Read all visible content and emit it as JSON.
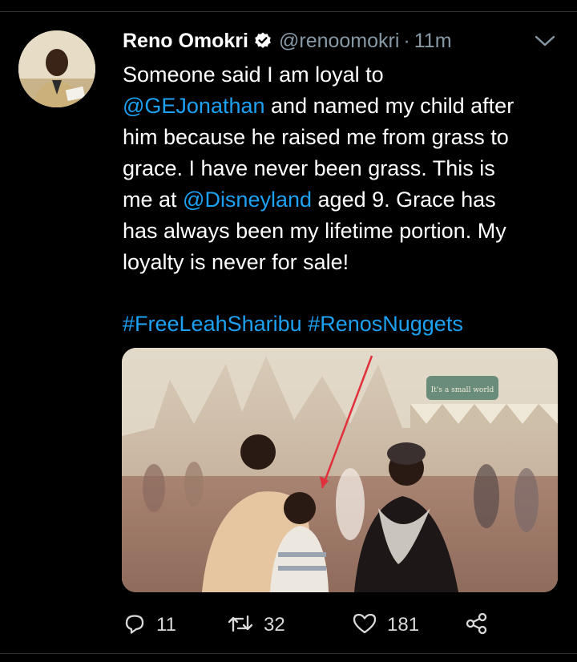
{
  "tweet": {
    "author": {
      "name": "Reno Omokri",
      "verified": true,
      "handle": "@renoomokri",
      "separator": "·",
      "time": "11m"
    },
    "lines": [
      {
        "text": "Someone said I am loyal to"
      },
      {
        "mention": "@GEJonathan",
        "text": " and named my child after"
      },
      {
        "text": "him because he raised me from grass to"
      },
      {
        "text": "grace. I have never been grass. This is"
      },
      {
        "pre": "me at ",
        "mention": "@Disneyland",
        "text": " aged 9. Grace has"
      },
      {
        "text": "has always been my lifetime portion. My"
      },
      {
        "text": "loyalty is never for sale!"
      }
    ],
    "hashtags": [
      "#FreeLeahSharibu",
      "#RenosNuggets"
    ],
    "photo": {
      "sign_text": "It's a small world"
    },
    "actions": {
      "reply_count": "11",
      "retweet_count": "32",
      "like_count": "181"
    }
  },
  "colors": {
    "background": "#000000",
    "link": "#1da1f2",
    "muted": "#8899a6",
    "divider": "#2f3336"
  },
  "icons": {
    "verified": "verified-badge-icon",
    "caret": "chevron-down-icon",
    "reply": "reply-icon",
    "retweet": "retweet-icon",
    "like": "heart-icon",
    "share": "share-icon"
  }
}
